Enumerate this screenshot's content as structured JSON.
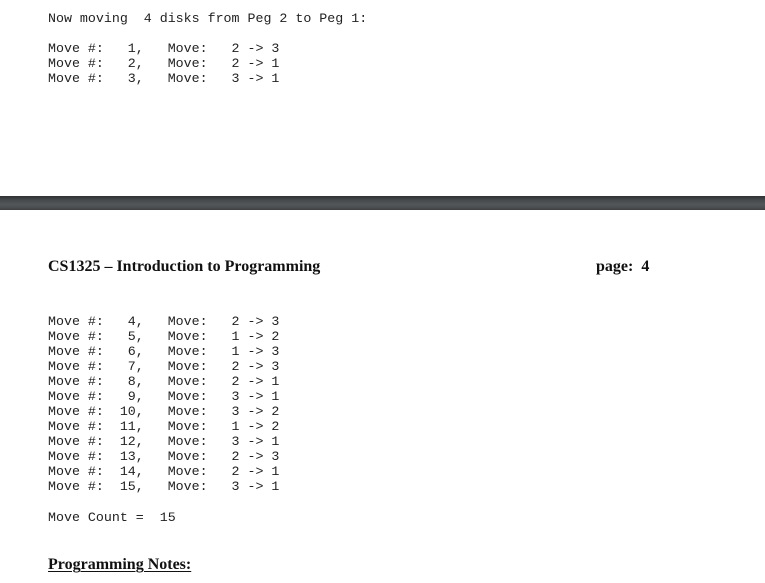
{
  "page1": {
    "intro_line": "Now moving  4 disks from Peg 2 to Peg 1:",
    "moves": [
      {
        "num": 1,
        "from": 2,
        "to": 3
      },
      {
        "num": 2,
        "from": 2,
        "to": 1
      },
      {
        "num": 3,
        "from": 3,
        "to": 1
      }
    ]
  },
  "page2": {
    "header": {
      "course_title": "CS1325 – Introduction to Programming",
      "page_label": "page:",
      "page_number": "4"
    },
    "moves": [
      {
        "num": 4,
        "from": 2,
        "to": 3
      },
      {
        "num": 5,
        "from": 1,
        "to": 2
      },
      {
        "num": 6,
        "from": 1,
        "to": 3
      },
      {
        "num": 7,
        "from": 2,
        "to": 3
      },
      {
        "num": 8,
        "from": 2,
        "to": 1
      },
      {
        "num": 9,
        "from": 3,
        "to": 1
      },
      {
        "num": 10,
        "from": 3,
        "to": 2
      },
      {
        "num": 11,
        "from": 1,
        "to": 2
      },
      {
        "num": 12,
        "from": 3,
        "to": 1
      },
      {
        "num": 13,
        "from": 2,
        "to": 3
      },
      {
        "num": 14,
        "from": 2,
        "to": 1
      },
      {
        "num": 15,
        "from": 3,
        "to": 1
      }
    ],
    "move_count_label": "Move Count =",
    "move_count_value": "15",
    "notes_heading": "Programming Notes:"
  },
  "labels": {
    "move_num_prefix": "Move #:",
    "move_prefix": "Move:",
    "arrow": "->"
  }
}
